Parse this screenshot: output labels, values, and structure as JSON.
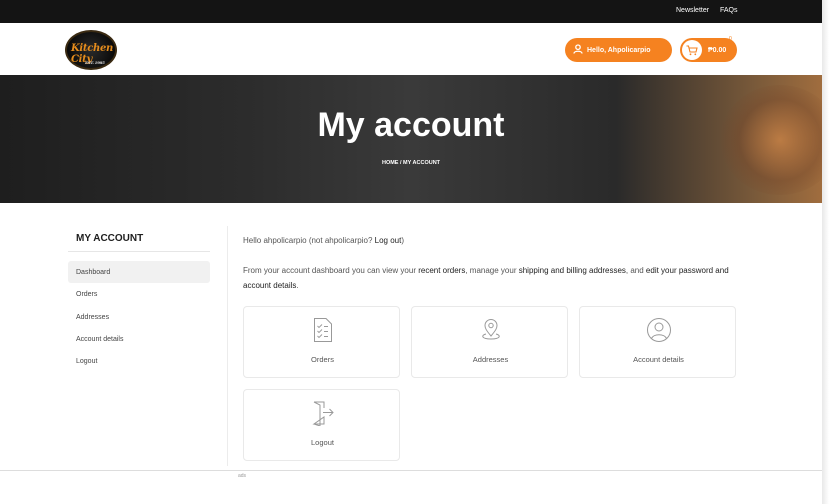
{
  "topbar": {
    "newsletter": "Newsletter",
    "faqs": "FAQs"
  },
  "header": {
    "logo_text": "Kitchen City",
    "logo_small": "EST. 1985",
    "hello_label": "Hello, Ahpolicarpio",
    "cart_total": "₱0.00",
    "cart_count": "0",
    "accent_color": "#f58220"
  },
  "hero": {
    "title": "My account",
    "breadcrumb": "HOME / MY ACCOUNT"
  },
  "sidebar": {
    "title": "MY ACCOUNT",
    "items": [
      {
        "label": "Dashboard",
        "active": true
      },
      {
        "label": "Orders"
      },
      {
        "label": "Addresses"
      },
      {
        "label": "Account details"
      },
      {
        "label": "Logout"
      }
    ]
  },
  "main": {
    "hello_prefix": "Hello ahpolicarpio (not ahpolicarpio? ",
    "logout_link": "Log out",
    "hello_suffix": ")",
    "intro": {
      "t1": "From your account dashboard you can view your ",
      "recent_orders": "recent orders",
      "t2": ", manage your ",
      "addresses": "shipping and billing addresses",
      "t3": ", and ",
      "account": "edit your password and account details",
      "t4": "."
    },
    "cards": [
      {
        "label": "Orders",
        "icon": "orders-icon"
      },
      {
        "label": "Addresses",
        "icon": "location-pin-icon"
      },
      {
        "label": "Account details",
        "icon": "user-circle-icon"
      },
      {
        "label": "Logout",
        "icon": "logout-door-icon"
      }
    ]
  },
  "footer": {
    "text": "ads"
  }
}
